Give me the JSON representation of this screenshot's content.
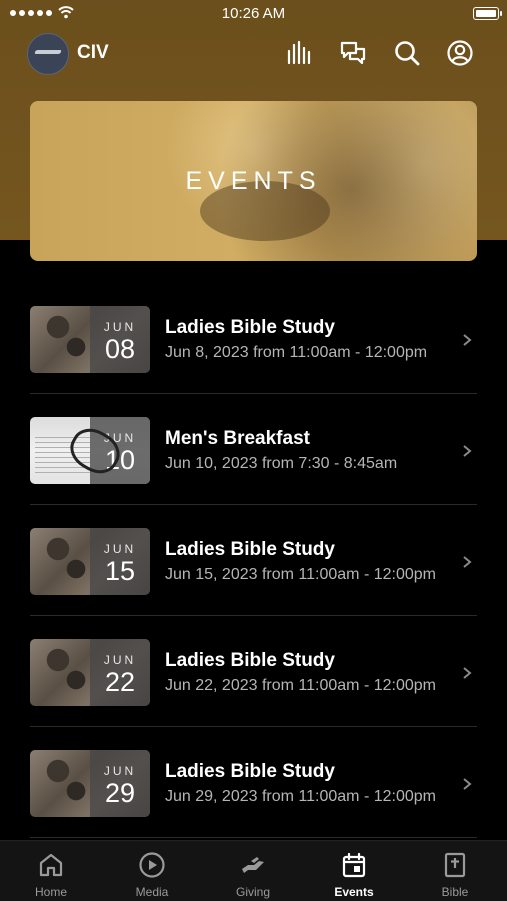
{
  "status_bar": {
    "time": "10:26 AM"
  },
  "header": {
    "org_name": "CIV"
  },
  "banner": {
    "title": "EVENTS"
  },
  "events": [
    {
      "title": "Ladies Bible Study",
      "subtitle": "Jun 8, 2023 from 11:00am - 12:00pm",
      "month": "JUN",
      "day": "08",
      "thumb": "rock"
    },
    {
      "title": "Men's Breakfast",
      "subtitle": "Jun 10, 2023 from 7:30 - 8:45am",
      "month": "JUN",
      "day": "10",
      "thumb": "book"
    },
    {
      "title": "Ladies Bible Study",
      "subtitle": "Jun 15, 2023 from 11:00am - 12:00pm",
      "month": "JUN",
      "day": "15",
      "thumb": "rock"
    },
    {
      "title": "Ladies Bible Study",
      "subtitle": "Jun 22, 2023 from 11:00am - 12:00pm",
      "month": "JUN",
      "day": "22",
      "thumb": "rock"
    },
    {
      "title": "Ladies Bible Study",
      "subtitle": "Jun 29, 2023 from 11:00am - 12:00pm",
      "month": "JUN",
      "day": "29",
      "thumb": "rock"
    }
  ],
  "tabs": [
    {
      "label": "Home",
      "icon": "home-icon"
    },
    {
      "label": "Media",
      "icon": "play-icon"
    },
    {
      "label": "Giving",
      "icon": "giving-icon"
    },
    {
      "label": "Events",
      "icon": "calendar-icon",
      "active": true
    },
    {
      "label": "Bible",
      "icon": "bible-icon"
    }
  ],
  "colors": {
    "header_bg": "#6b4f1c",
    "banner_bg": "#c8a45a",
    "background": "#000000",
    "subtitle_text": "#b5b5b5",
    "tab_inactive": "#9a9a9a"
  }
}
